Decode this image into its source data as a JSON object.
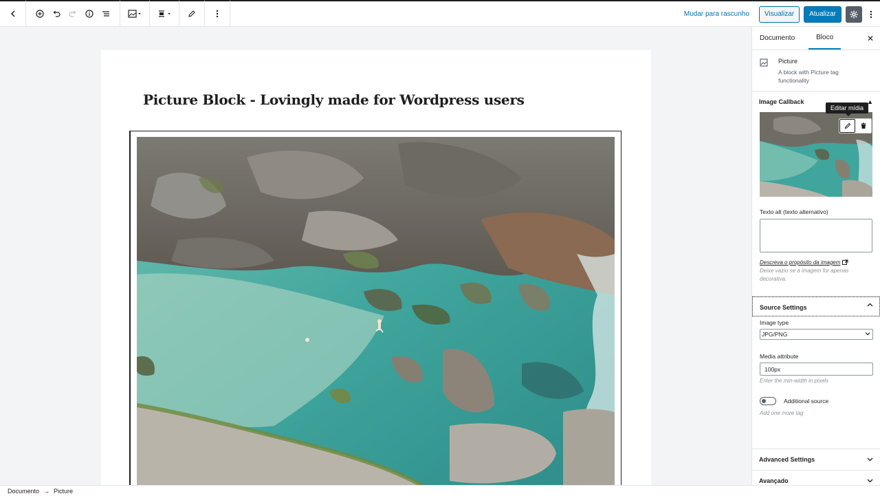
{
  "toolbar": {
    "back_icon": "chevron-left-icon",
    "draft_label": "Mudar para rascunho",
    "preview_label": "Visualizar",
    "update_label": "Atualizar"
  },
  "post": {
    "title": "Picture Block - Lovingly made for Wordpress users"
  },
  "statusbar": {
    "crumbs": [
      "Documento",
      "Picture"
    ],
    "separator": "→"
  },
  "sidebar": {
    "tabs": [
      "Documento",
      "Bloco"
    ],
    "active_tab": "Bloco",
    "block": {
      "name": "Picture",
      "description": "A block with Picture tag functionality"
    },
    "image_callback": {
      "title": "Image Callback",
      "tooltip": "Editar mídia",
      "alt_label": "Texto alt (texto alternativo)",
      "alt_value": "",
      "alt_link": "Descreva o propósito da imagem",
      "alt_help": "Deixe vazio se a imagem for apenas decorativa."
    },
    "source_settings": {
      "title": "Source Settings",
      "image_type_label": "Image type",
      "image_type_value": "JPG/PNG",
      "media_attr_label": "Media attribute",
      "media_attr_value": "100px",
      "media_attr_help": "Enter the min-width in pixels",
      "additional_label": "Additional source",
      "additional_help": "Add one more tag",
      "additional_enabled": false
    },
    "advanced_settings_title": "Advanced Settings",
    "advanced_title": "Avançado"
  },
  "colors": {
    "accent": "#007cba",
    "link": "#0073aa",
    "dark": "#1e1e1e"
  }
}
